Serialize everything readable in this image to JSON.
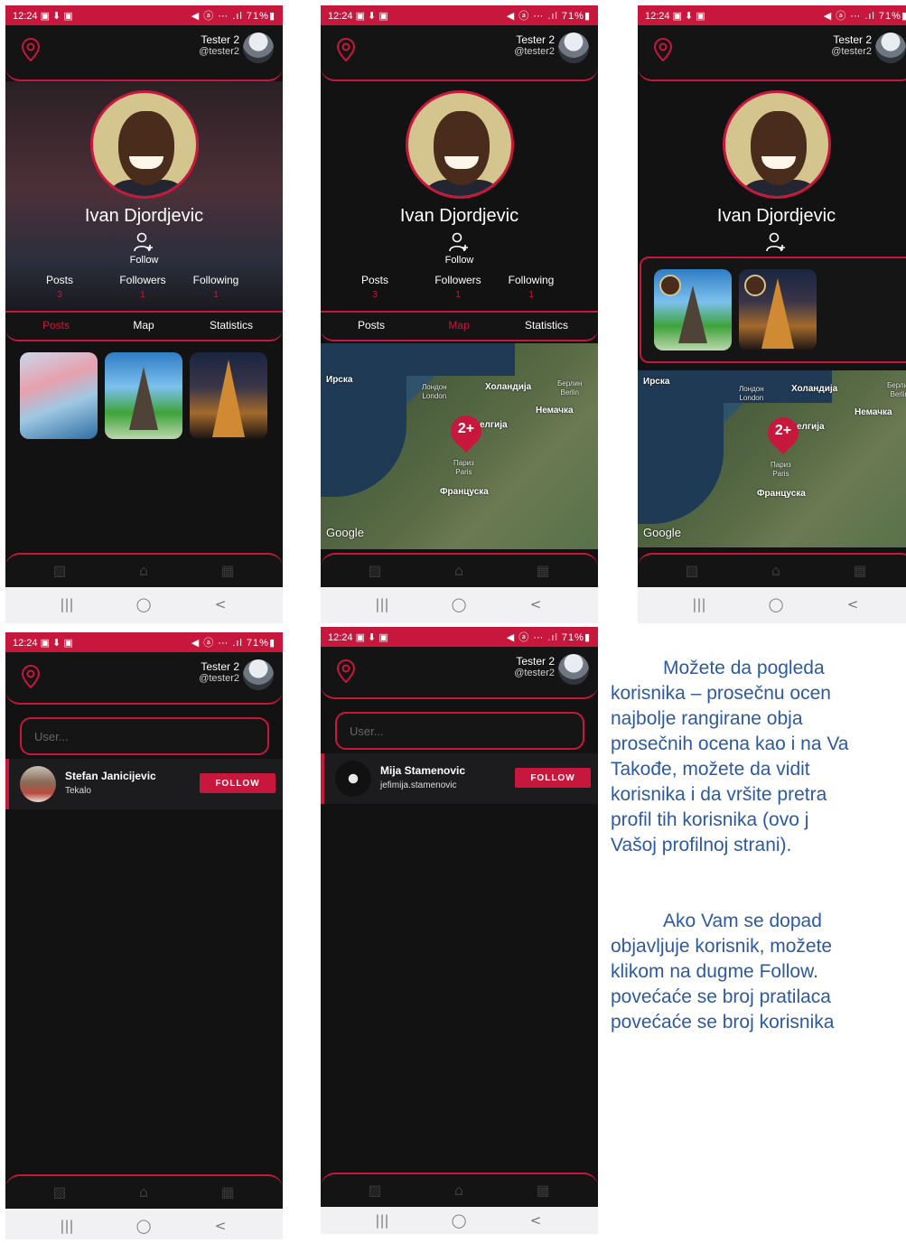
{
  "status": {
    "time": "12:24",
    "icons": "▣ ⬇ ▣",
    "right": "◀ ⓐ ⋯ .ıl 71%▮"
  },
  "header": {
    "user_name": "Tester 2",
    "user_handle": "@tester2"
  },
  "profile": {
    "name": "Ivan Djordjevic",
    "follow_label": "Follow",
    "stats": [
      {
        "label": "Posts",
        "value": "3"
      },
      {
        "label": "Followers",
        "value": "1"
      },
      {
        "label": "Following",
        "value": "1"
      }
    ]
  },
  "tabs": [
    "Posts",
    "Map",
    "Statistics"
  ],
  "map": {
    "labels": {
      "ireland": "Ирска",
      "london_cyr": "Лондон",
      "london": "London",
      "netherlands": "Холандија",
      "berlin_cyr": "Берлин",
      "berlin": "Berlin",
      "germany": "Немачка",
      "belgium": "елгија",
      "paris_cyr": "Париз",
      "paris": "Paris",
      "france": "Француска"
    },
    "cluster_count": "2+",
    "attribution": "Google"
  },
  "search": {
    "placeholder": "User..."
  },
  "results": [
    {
      "name": "Stefan Janicijevic",
      "handle": "Tekalo",
      "button": "FOLLOW"
    },
    {
      "name": "Mija Stamenovic",
      "handle": "jefimija.stamenovic",
      "button": "FOLLOW"
    }
  ],
  "sysnav": {
    "recent": "|||",
    "home": "◯",
    "back": "<"
  },
  "doc": {
    "p1": [
      "Možete da pogleda",
      "korisnika – prosečnu ocen",
      "najbolje rangirane obja",
      "prosečnih ocena kao i na Va",
      "Takođe, možete da vidit",
      "korisnika i da vršite pretra",
      "profil tih korisnika (ovo j",
      "Vašoj profilnoj strani)."
    ],
    "p2": [
      "Ako Vam se dopad",
      "objavljuje korisnik, možete",
      "klikom na dugme Follow.",
      "povećaće se broj pratilaca",
      "povećaće se broj korisnika"
    ]
  },
  "colors": {
    "accent": "#c8173c",
    "background": "#121212",
    "doc_text": "#2b5aa3"
  }
}
